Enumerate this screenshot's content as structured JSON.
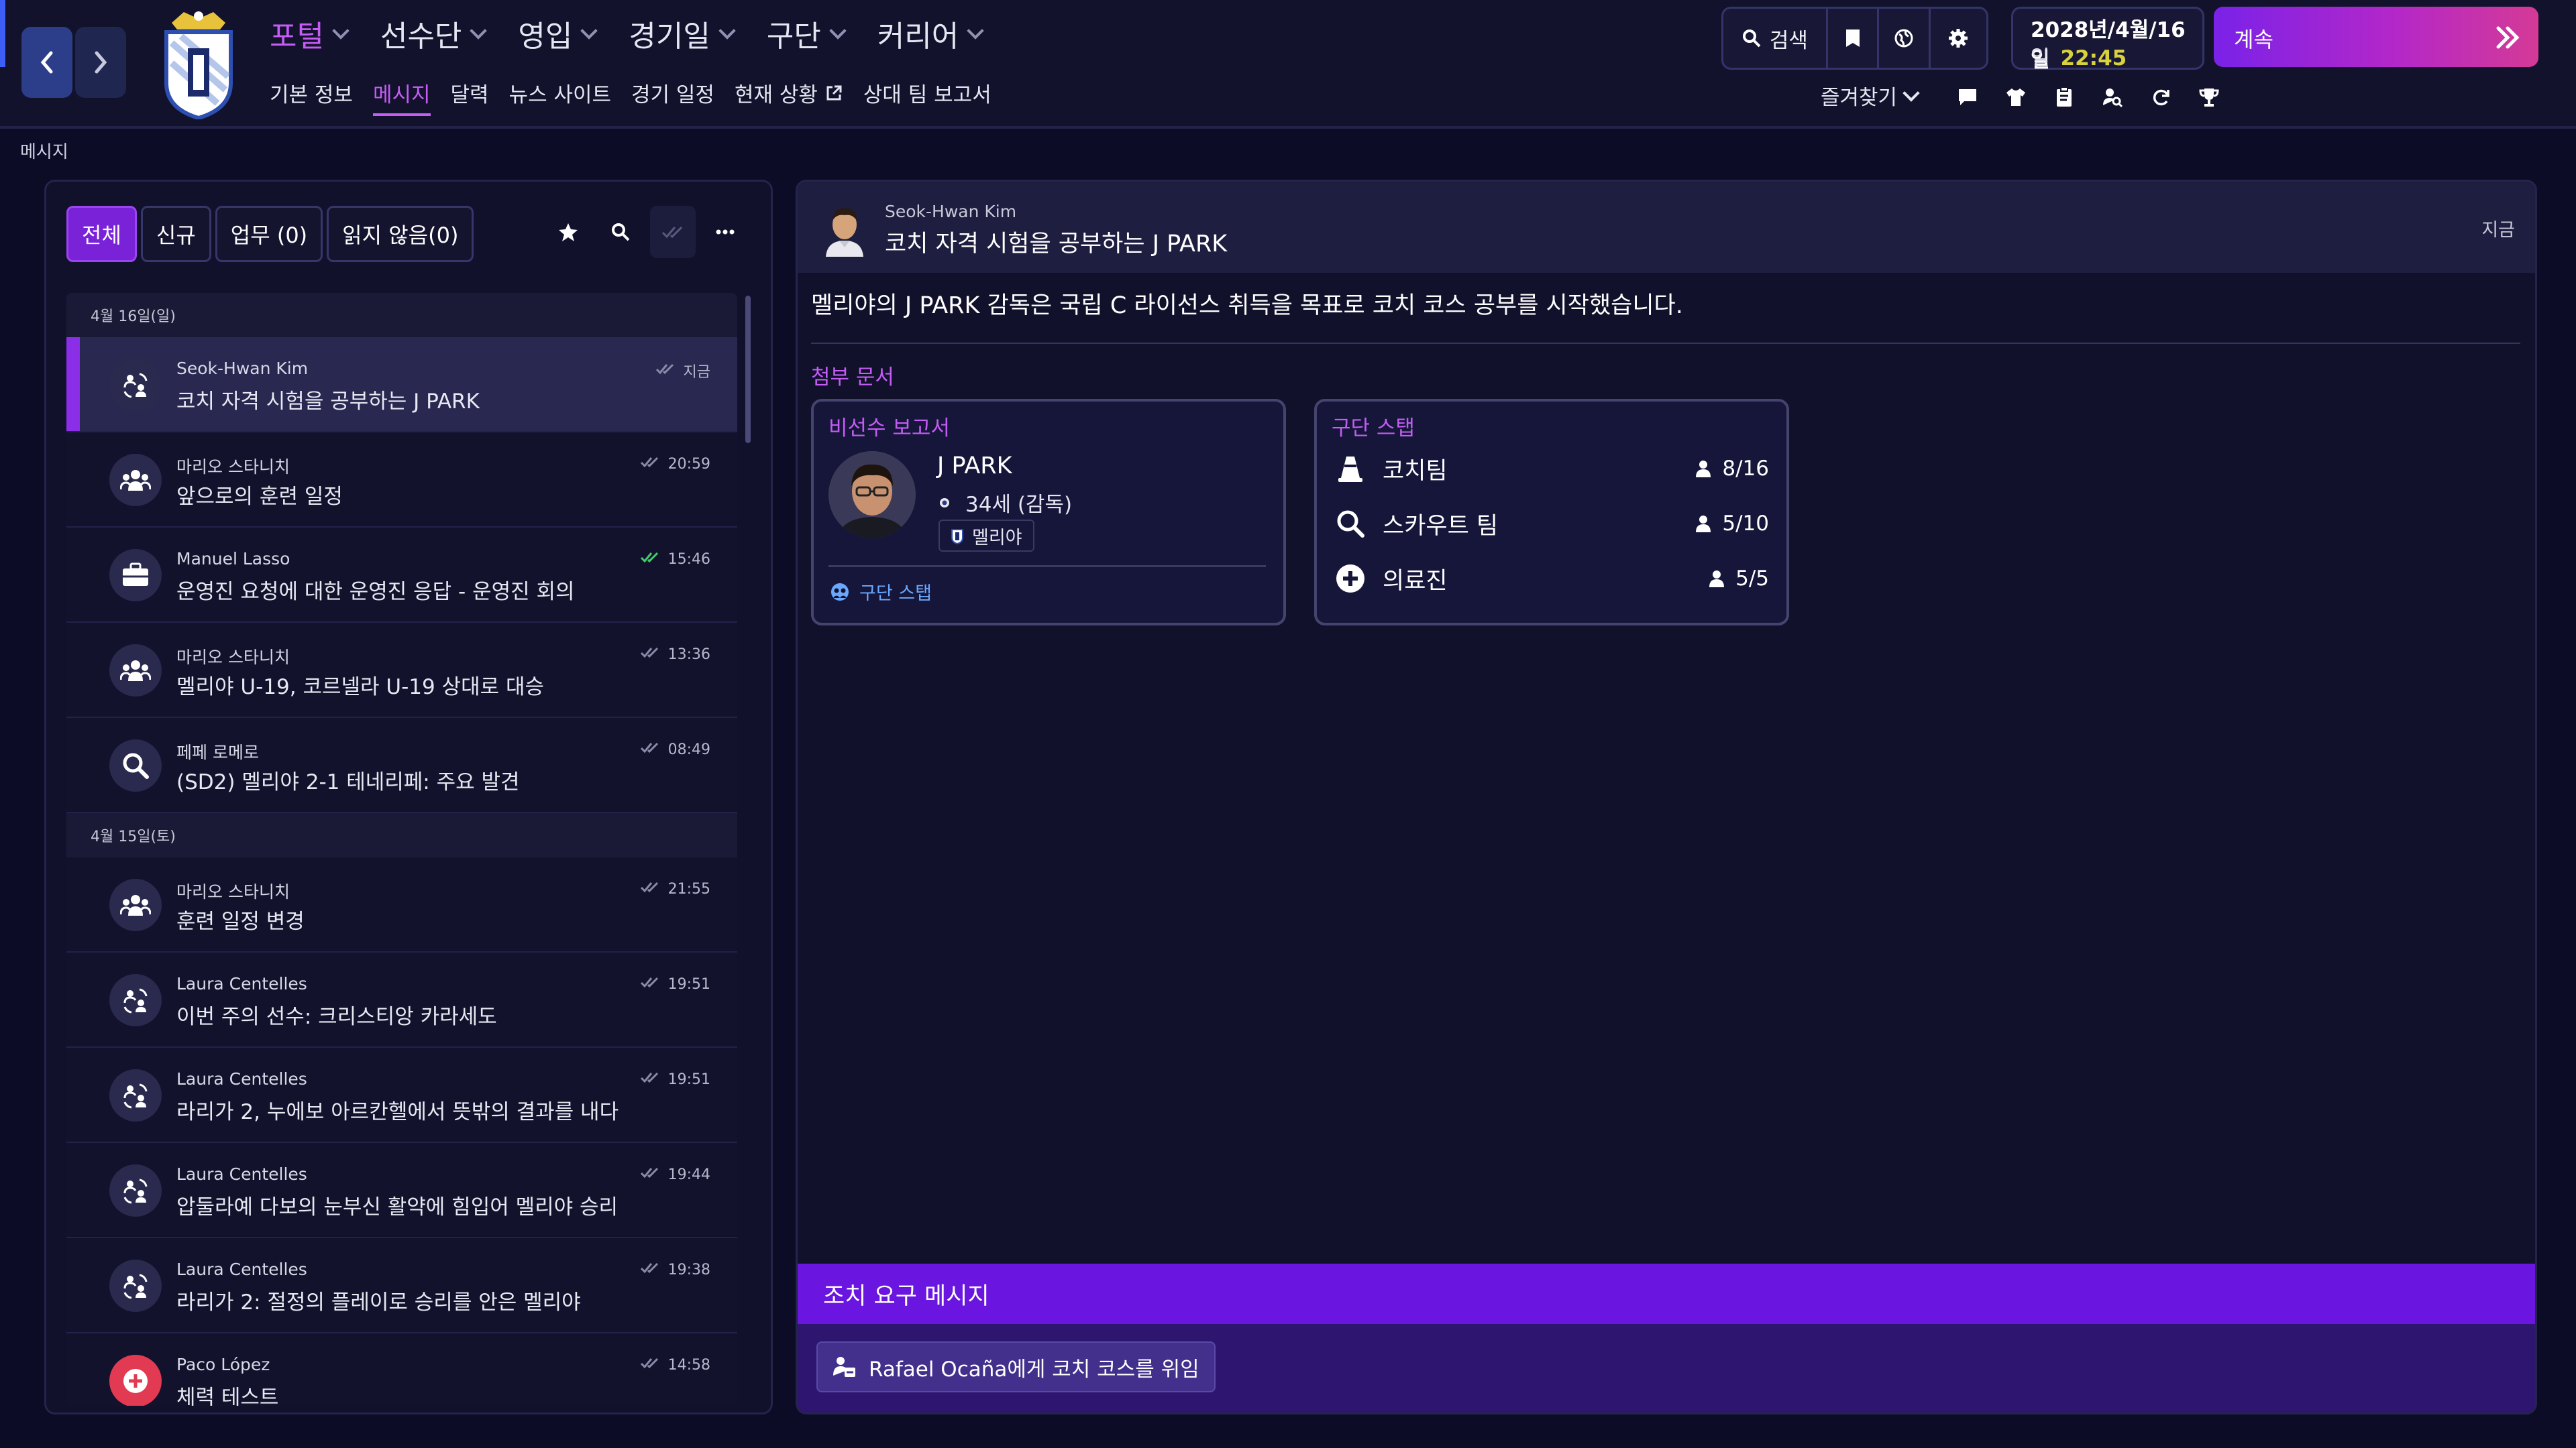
{
  "nav": {
    "menu": [
      {
        "label": "포털"
      },
      {
        "label": "선수단"
      },
      {
        "label": "영입"
      },
      {
        "label": "경기일"
      },
      {
        "label": "구단"
      },
      {
        "label": "커리어"
      }
    ],
    "submenu": [
      {
        "label": "기본 정보"
      },
      {
        "label": "메시지"
      },
      {
        "label": "달력"
      },
      {
        "label": "뉴스 사이트"
      },
      {
        "label": "경기 일정"
      },
      {
        "label": "현재 상황"
      },
      {
        "label": "상대 팀 보고서"
      }
    ],
    "search_label": "검색",
    "date_line": "2028년/4월/16일",
    "day_label": "일",
    "time": "22:45",
    "continue_label": "계속",
    "bookmarks_label": "즐겨찾기"
  },
  "page_label": "메시지",
  "inbox": {
    "filters": [
      {
        "label": "전체"
      },
      {
        "label": "신규"
      },
      {
        "label": "업무 (0)"
      },
      {
        "label": "읽지 않음(0)"
      }
    ],
    "groups": [
      {
        "date": "4월 16일(일)",
        "messages": [
          {
            "sender": "Seok-Hwan Kim",
            "subject": "코치 자격 시험을 공부하는 J PARK",
            "time": "지금",
            "icon": "staff-transfer-icon"
          },
          {
            "sender": "마리오 스타니치",
            "subject": "앞으로의 훈련 일정",
            "time": "20:59",
            "icon": "group-icon"
          },
          {
            "sender": "Manuel Lasso",
            "subject": "운영진 요청에 대한 운영진 응답 - 운영진 회의",
            "time": "15:46",
            "icon": "briefcase-icon"
          },
          {
            "sender": "마리오 스타니치",
            "subject": "멜리야 U-19, 코르넬라 U-19 상대로 대승",
            "time": "13:36",
            "icon": "group-icon"
          },
          {
            "sender": "페페 로메로",
            "subject": "(SD2) 멜리야 2-1 테네리페: 주요 발견",
            "time": "08:49",
            "icon": "magnifier-icon"
          }
        ]
      },
      {
        "date": "4월 15일(토)",
        "messages": [
          {
            "sender": "마리오 스타니치",
            "subject": "훈련 일정 변경",
            "time": "21:55",
            "icon": "group-icon"
          },
          {
            "sender": "Laura Centelles",
            "subject": "이번 주의 선수: 크리스티앙 카라세도",
            "time": "19:51",
            "icon": "staff-transfer-icon"
          },
          {
            "sender": "Laura Centelles",
            "subject": "라리가 2, 누에보 아르칸헬에서 뜻밖의 결과를 내다",
            "time": "19:51",
            "icon": "staff-transfer-icon"
          },
          {
            "sender": "Laura Centelles",
            "subject": "압둘라예 다보의 눈부신 활약에 힘입어 멜리야 승리",
            "time": "19:44",
            "icon": "staff-transfer-icon"
          },
          {
            "sender": "Laura Centelles",
            "subject": "라리가 2: 절정의 플레이로 승리를 안은 멜리야",
            "time": "19:38",
            "icon": "staff-transfer-icon"
          },
          {
            "sender": "Paco López",
            "subject": "체력 테스트",
            "time": "14:58",
            "icon": "medical-plus-icon"
          }
        ]
      }
    ]
  },
  "message": {
    "from": "Seok-Hwan Kim",
    "title": "코치 자격 시험을 공부하는 J PARK",
    "when": "지금",
    "body": "멜리야의 J PARK 감독은 국립 C 라이선스 취득을 목표로 코치 코스 공부를 시작했습니다.",
    "attachments_label": "첨부 문서",
    "report_card": {
      "title": "비선수 보고서",
      "name": "J PARK",
      "age_role": "34세 (감독)",
      "club": "멜리야",
      "link": "구단 스탭"
    },
    "staff_card": {
      "title": "구단 스탭",
      "rows": [
        {
          "label": "코치팀",
          "count": "8/16",
          "icon": "cone-icon"
        },
        {
          "label": "스카우트 팀",
          "count": "5/10",
          "icon": "magnifier-icon"
        },
        {
          "label": "의료진",
          "count": "5/5",
          "icon": "medical-plus-icon"
        }
      ]
    },
    "action_required_label": "조치 요구 메시지",
    "action_button": "Rafael Ocaña에게 코치 코스를 위임"
  },
  "colors": {
    "accent": "#c55cf5",
    "selected_bar": "#8a2ee8",
    "continue_gradient": [
      "#7a22e8",
      "#d43a96"
    ],
    "time_highlight": "#d8d23c",
    "link": "#6aa8ff"
  }
}
